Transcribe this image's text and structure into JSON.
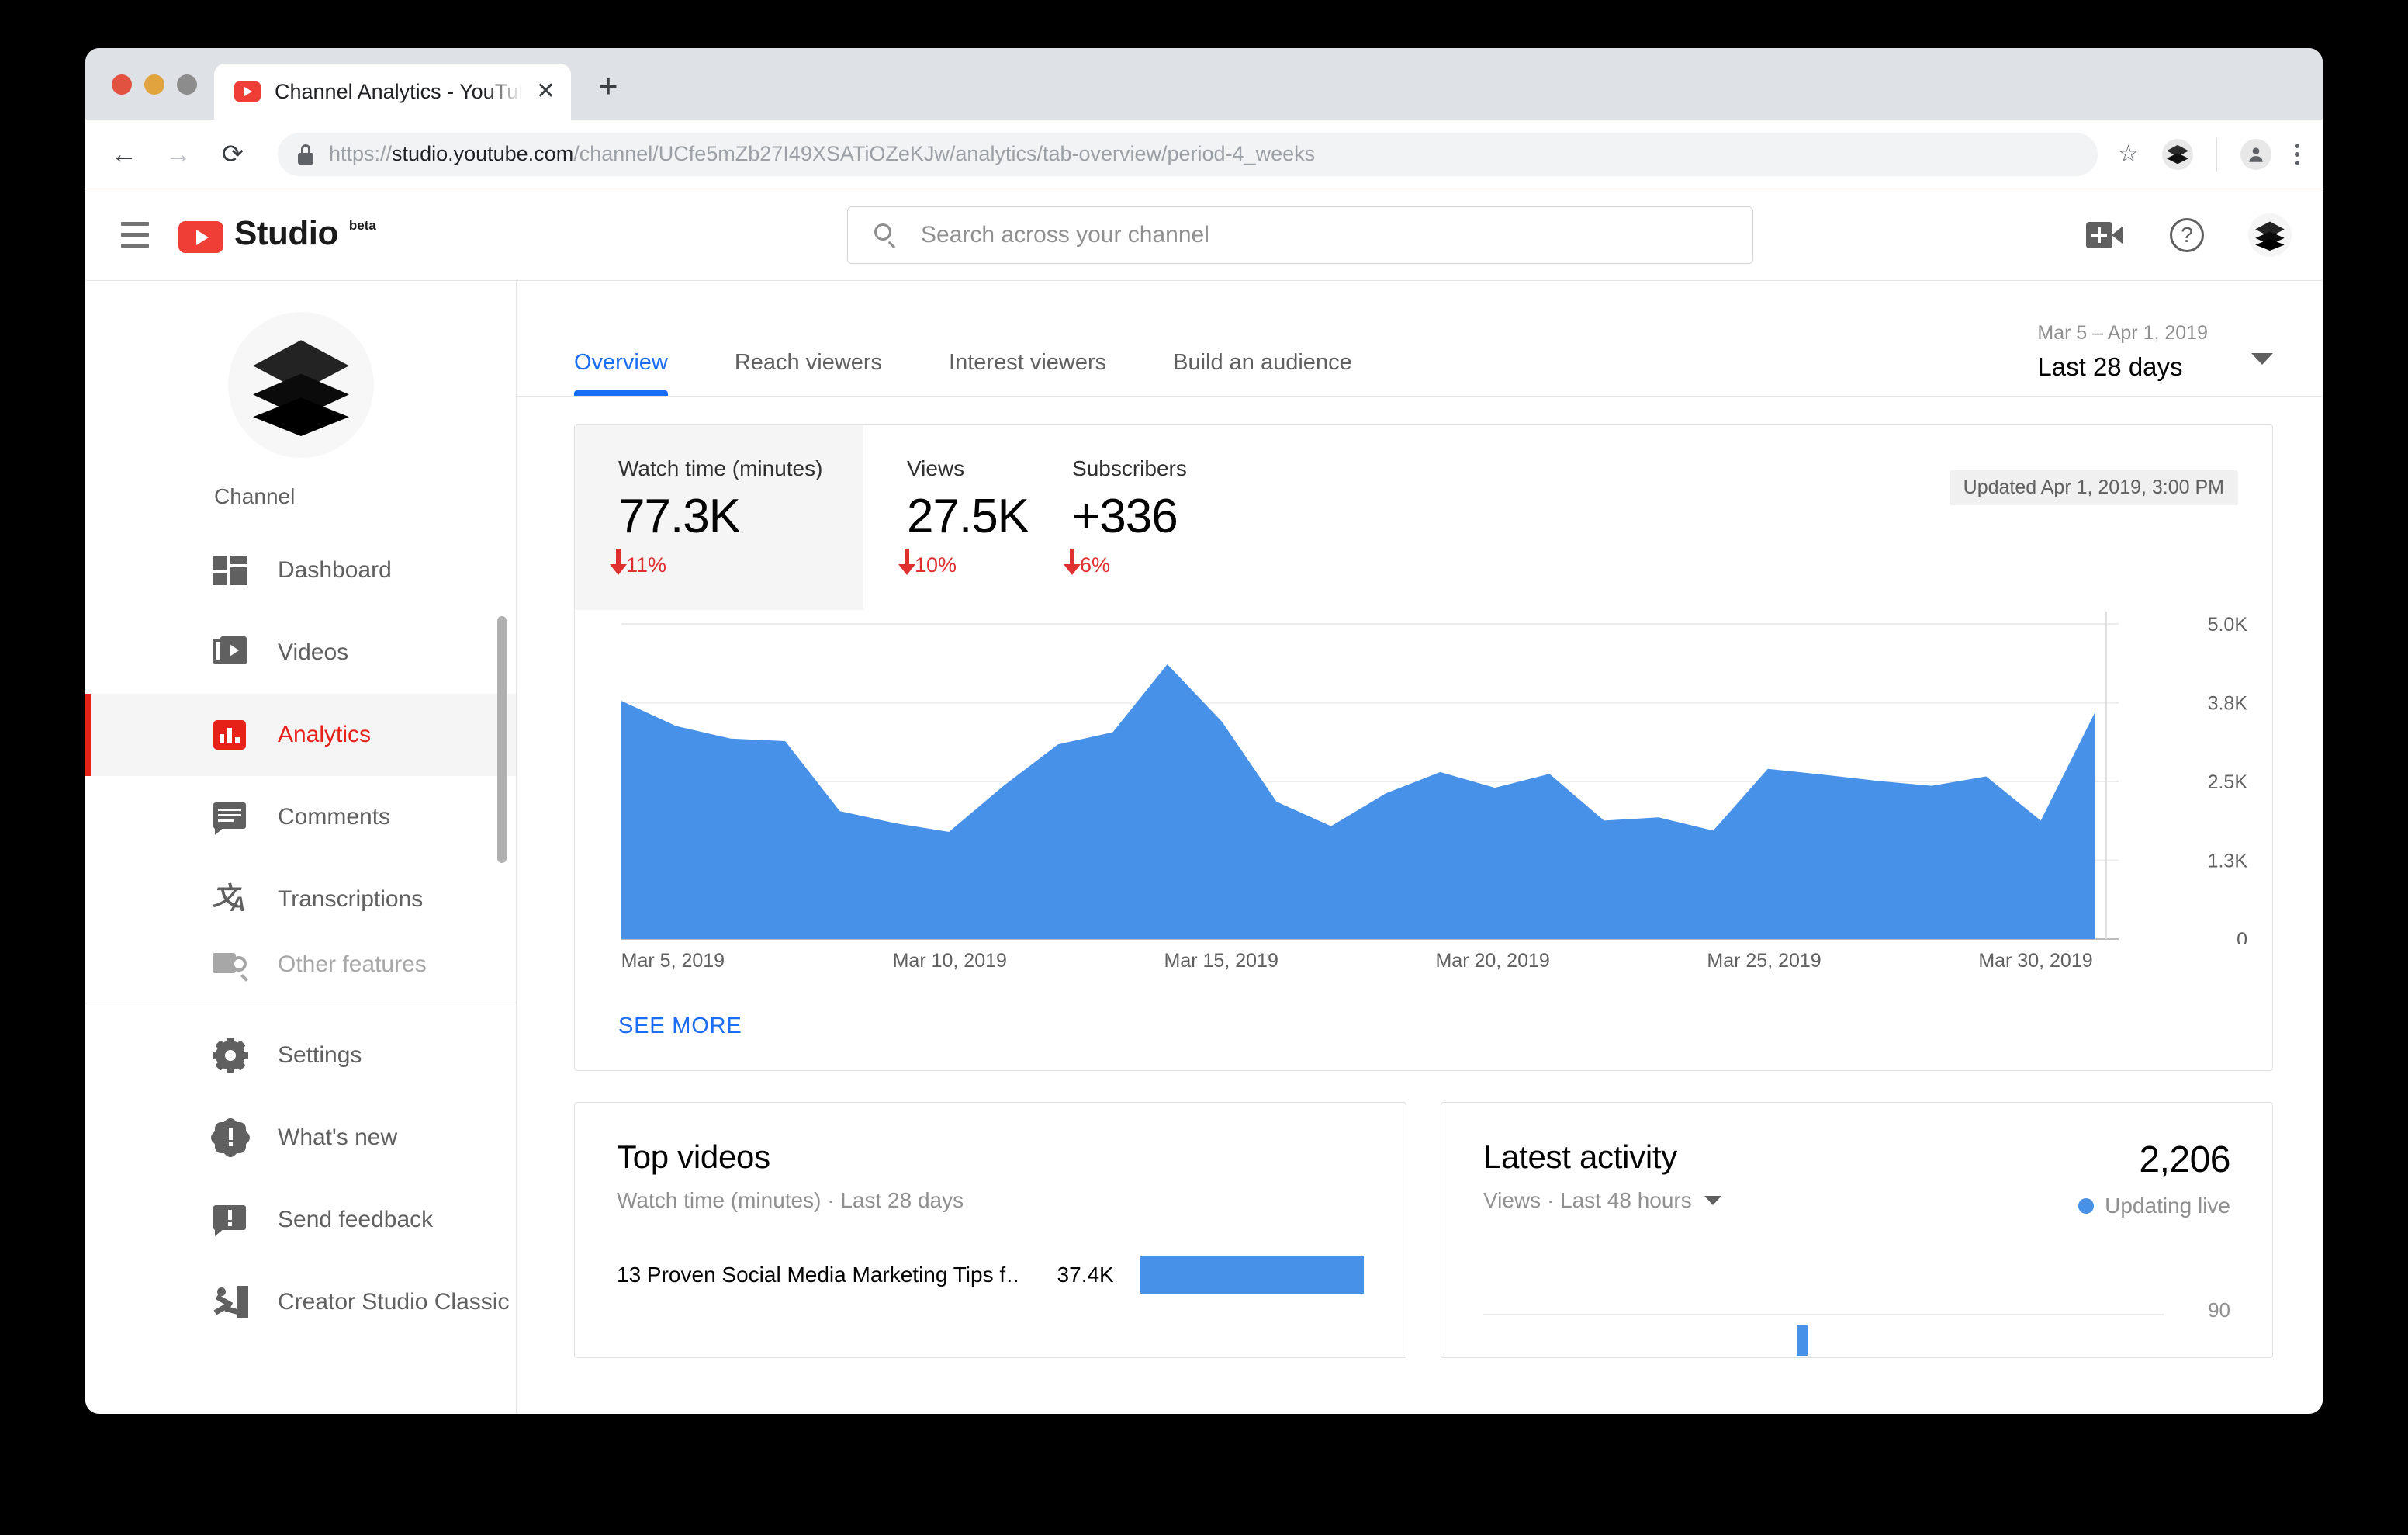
{
  "browser": {
    "tab_title": "Channel Analytics - YouTube Studio",
    "tab_close_glyph": "✕",
    "new_tab_glyph": "+",
    "back_glyph": "←",
    "forward_glyph": "→",
    "reload_glyph": "⟳",
    "url_scheme": "https://",
    "url_host": "studio.youtube.com",
    "url_path": "/channel/UCfe5mZb27I49XSATiOZeKJw/analytics/tab-overview/period-4_weeks",
    "star_glyph": "☆"
  },
  "masthead": {
    "logo_word": "Studio",
    "logo_beta": "beta",
    "search_placeholder": "Search across your channel",
    "search_value": "",
    "help_glyph": "?"
  },
  "sidebar": {
    "section_label": "Channel",
    "items": [
      {
        "label": "Dashboard",
        "icon": "dashboard-icon",
        "active": false
      },
      {
        "label": "Videos",
        "icon": "videos-icon",
        "active": false
      },
      {
        "label": "Analytics",
        "icon": "analytics-icon",
        "active": true
      },
      {
        "label": "Comments",
        "icon": "comments-icon",
        "active": false
      },
      {
        "label": "Transcriptions",
        "icon": "transcriptions-icon",
        "active": false
      },
      {
        "label": "Other features",
        "icon": "other-features-icon",
        "active": false
      }
    ],
    "footer_items": [
      {
        "label": "Settings",
        "icon": "gear-icon"
      },
      {
        "label": "What's new",
        "icon": "whats-new-icon"
      },
      {
        "label": "Send feedback",
        "icon": "send-feedback-icon"
      },
      {
        "label": "Creator Studio Classic",
        "icon": "exit-icon"
      }
    ]
  },
  "main": {
    "tabs": [
      {
        "label": "Overview",
        "active": true
      },
      {
        "label": "Reach viewers",
        "active": false
      },
      {
        "label": "Interest viewers",
        "active": false
      },
      {
        "label": "Build an audience",
        "active": false
      }
    ],
    "date_range": {
      "range_text": "Mar 5 – Apr 1, 2019",
      "preset": "Last 28 days"
    },
    "updated_badge": "Updated Apr 1, 2019, 3:00 PM",
    "metrics": [
      {
        "label": "Watch time (minutes)",
        "value": "77.3K",
        "delta": "11%",
        "direction": "down",
        "selected": true
      },
      {
        "label": "Views",
        "value": "27.5K",
        "delta": "10%",
        "direction": "down",
        "selected": false
      },
      {
        "label": "Subscribers",
        "value": "+336",
        "delta": "6%",
        "direction": "down",
        "selected": false
      }
    ],
    "see_more": "SEE MORE"
  },
  "top_videos": {
    "title": "Top videos",
    "subtitle": "Watch time (minutes) · Last 28 days",
    "rows": [
      {
        "title": "13 Proven Social Media Marketing Tips f…",
        "value": "37.4K",
        "bar_pct": 100
      }
    ]
  },
  "latest_activity": {
    "title": "Latest activity",
    "subtitle": "Views · Last 48 hours",
    "count": "2,206",
    "live_label": "Updating live",
    "axis_value": "90"
  },
  "colors": {
    "accent_blue": "#1b6ef3",
    "chart_blue": "#4891e8",
    "youtube_red": "#e62117",
    "negative_red": "#e02f2f",
    "muted_grey": "#606060"
  },
  "chart_data": {
    "type": "area",
    "title": "Watch time (minutes)",
    "xlabel": "",
    "ylabel": "Watch time (minutes)",
    "ylim": [
      0,
      5000
    ],
    "ytick_labels": [
      "0",
      "1.3K",
      "2.5K",
      "3.8K",
      "5.0K"
    ],
    "ytick_values": [
      0,
      1250,
      2500,
      3750,
      5000
    ],
    "xtick_labels": [
      "Mar 5, 2019",
      "Mar 10, 2019",
      "Mar 15, 2019",
      "Mar 20, 2019",
      "Mar 25, 2019",
      "Mar 30, 2019"
    ],
    "xtick_indices": [
      0,
      5,
      10,
      15,
      20,
      25
    ],
    "grid": true,
    "legend": "none",
    "series": [
      {
        "name": "Watch time (minutes)",
        "x": [
          "Mar 5, 2019",
          "Mar 6, 2019",
          "Mar 7, 2019",
          "Mar 8, 2019",
          "Mar 9, 2019",
          "Mar 10, 2019",
          "Mar 11, 2019",
          "Mar 12, 2019",
          "Mar 13, 2019",
          "Mar 14, 2019",
          "Mar 15, 2019",
          "Mar 16, 2019",
          "Mar 17, 2019",
          "Mar 18, 2019",
          "Mar 19, 2019",
          "Mar 20, 2019",
          "Mar 21, 2019",
          "Mar 22, 2019",
          "Mar 23, 2019",
          "Mar 24, 2019",
          "Mar 25, 2019",
          "Mar 26, 2019",
          "Mar 27, 2019",
          "Mar 28, 2019",
          "Mar 29, 2019",
          "Mar 30, 2019",
          "Mar 31, 2019",
          "Apr 1, 2019"
        ],
        "values": [
          3780,
          3380,
          3180,
          3140,
          2030,
          1840,
          1700,
          2430,
          3090,
          3280,
          4360,
          3450,
          2180,
          1790,
          2310,
          2650,
          2400,
          2620,
          1880,
          1930,
          1720,
          2700,
          2610,
          2510,
          2430,
          2580,
          1880,
          3610
        ]
      }
    ]
  }
}
